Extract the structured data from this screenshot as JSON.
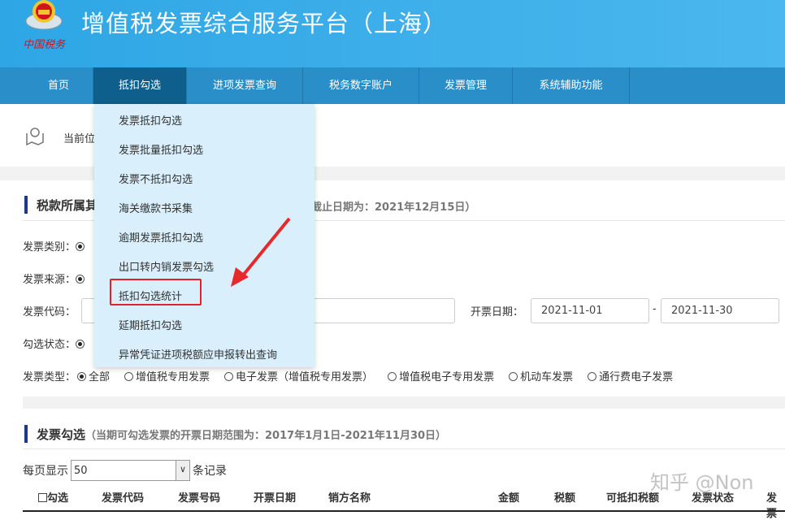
{
  "header": {
    "title": "增值税发票综合服务平台（上海）",
    "logo_text": "中国税务"
  },
  "nav": [
    {
      "label": "首页"
    },
    {
      "label": "抵扣勾选"
    },
    {
      "label": "进项发票查询"
    },
    {
      "label": "税务数字账户"
    },
    {
      "label": "发票管理"
    },
    {
      "label": "系统辅助功能"
    }
  ],
  "dropdown": [
    {
      "label": "发票抵扣勾选"
    },
    {
      "label": "发票批量抵扣勾选"
    },
    {
      "label": "发票不抵扣勾选"
    },
    {
      "label": "海关缴款书采集"
    },
    {
      "label": "逾期发票抵扣勾选"
    },
    {
      "label": "出口转内销发票勾选"
    },
    {
      "label": "抵扣勾选统计"
    },
    {
      "label": "延期抵扣勾选"
    },
    {
      "label": "异常凭证进项税额应申报转出查询"
    }
  ],
  "breadcrumb": {
    "label": "当前位"
  },
  "section1": {
    "title": "税款所属其",
    "note": "的截止日期为：2021年12月15日）"
  },
  "form": {
    "invoice_category": "发票类别：",
    "invoice_source": "发票来源：",
    "invoice_code": "发票代码：",
    "select_status": "勾选状态：",
    "issue_date": "开票日期：",
    "date_from": "2021-11-01",
    "date_sep": "-",
    "date_to": "2021-11-30",
    "invoice_type": "发票类型：",
    "type_options": [
      {
        "label": "全部",
        "checked": true
      },
      {
        "label": "增值税专用发票",
        "checked": false
      },
      {
        "label": "电子发票（增值税专用发票）",
        "checked": false
      },
      {
        "label": "增值税电子专用发票",
        "checked": false
      },
      {
        "label": "机动车发票",
        "checked": false
      },
      {
        "label": "通行费电子发票",
        "checked": false
      }
    ]
  },
  "section2": {
    "title": "发票勾选",
    "note": "（当期可勾选发票的开票日期范围为：2017年1月1日-2021年11月30日）"
  },
  "paging": {
    "prefix": "每页显示",
    "value": "50",
    "suffix": "条记录"
  },
  "table": {
    "columns": [
      "勾选",
      "发票代码",
      "发票号码",
      "开票日期",
      "销方名称",
      "金额",
      "税额",
      "可抵扣税额",
      "发票状态",
      "发票"
    ]
  },
  "watermark": "知乎 @Non",
  "colors": {
    "header": "#2ea6e5",
    "nav": "#2a8fc8",
    "nav_active": "#0e5f8b",
    "dropdown": "#d9effb",
    "highlight": "#e0232a"
  }
}
